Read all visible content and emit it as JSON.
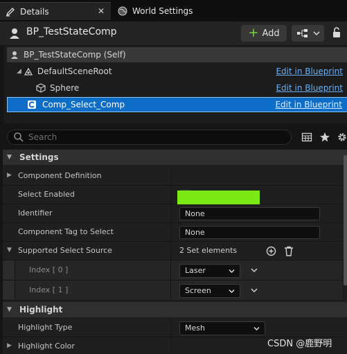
{
  "tabs": [
    {
      "label": "Details",
      "icon": "pencil-icon",
      "close": "✕"
    },
    {
      "label": "World Settings",
      "icon": "globe-icon"
    }
  ],
  "header": {
    "title": "BP_TestStateComp",
    "add_label": "Add"
  },
  "tree": {
    "self": "BP_TestStateComp (Self)",
    "items": [
      {
        "label": "DefaultSceneRoot",
        "edit": "Edit in Blueprint"
      },
      {
        "label": "Sphere",
        "edit": "Edit in Blueprint"
      },
      {
        "label": "Comp_Select_Comp",
        "edit": "Edit in Blueprint"
      }
    ]
  },
  "search": {
    "placeholder": "Search"
  },
  "settings": {
    "category": "Settings",
    "rows": {
      "component_definition": "Component Definition",
      "select_enabled": "Select Enabled",
      "identifier": "Identifier",
      "identifier_value": "None",
      "tag_to_select": "Component Tag to Select",
      "tag_value": "None",
      "supported_source": "Supported Select Source",
      "supported_count": "2 Set elements",
      "index0": "Index [ 0 ]",
      "index0_value": "Laser",
      "index1": "Index [ 1 ]",
      "index1_value": "Screen"
    }
  },
  "highlight": {
    "category": "Highlight",
    "type_label": "Highlight Type",
    "type_value": "Mesh",
    "color_label": "Highlight Color",
    "color": "#7be914"
  },
  "colors": {
    "accent": "#0e6ec7",
    "link": "#6ab0f5",
    "add_plus": "#7cd63a",
    "checkmark": "#2f8de0"
  },
  "watermark": "CSDN @鹿野明"
}
